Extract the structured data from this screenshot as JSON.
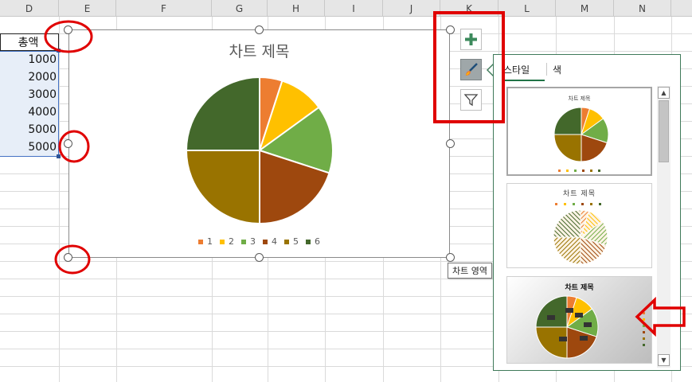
{
  "columns": [
    "D",
    "E",
    "F",
    "G",
    "H",
    "I",
    "J",
    "K",
    "L",
    "M",
    "N"
  ],
  "sheet": {
    "header_label": "총액",
    "values": [
      "1000",
      "2000",
      "3000",
      "4000",
      "5000",
      "5000"
    ]
  },
  "chart": {
    "title": "차트 제목",
    "tooltip": "차트 영역",
    "colors": [
      "#ed7d31",
      "#ffc000",
      "#70ad47",
      "#9e480e",
      "#997300",
      "#43682b"
    ],
    "chart_data": {
      "type": "pie",
      "title": "차트 제목",
      "categories": [
        "1",
        "2",
        "3",
        "4",
        "5",
        "6"
      ],
      "values": [
        1000,
        2000,
        3000,
        4000,
        5000,
        5000
      ],
      "legend_position": "bottom"
    }
  },
  "buttons": {
    "add_element_icon": "plus-icon",
    "styles_icon": "brush-icon",
    "filter_icon": "funnel-icon"
  },
  "styles_pane": {
    "tabs": [
      "스타일",
      "색"
    ],
    "active_tab": "스타일",
    "thumbnails": [
      {
        "title": "차트 제목"
      },
      {
        "title": "차트 제목"
      },
      {
        "title": "차트 제목"
      }
    ]
  }
}
